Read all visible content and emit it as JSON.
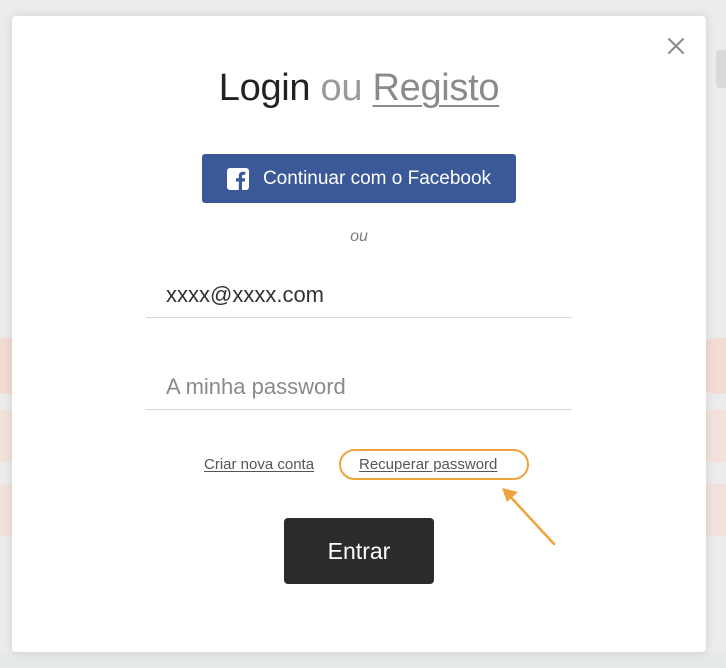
{
  "modal": {
    "title": {
      "login": "Login",
      "separator": "ou",
      "register_link": "Registo"
    },
    "close_icon": "close-icon",
    "facebook_button": {
      "label": "Continuar com o Facebook",
      "icon": "facebook-icon",
      "color": "#3b5998"
    },
    "divider_text": "ou",
    "email_input": {
      "value": "xxxx@xxxx.com"
    },
    "password_input": {
      "placeholder": "A minha password",
      "value": ""
    },
    "links": {
      "create_account": "Criar nova conta",
      "recover_password": "Recuperar password"
    },
    "submit_button": {
      "label": "Entrar",
      "color": "#2b2b2b"
    },
    "annotation": {
      "color": "#f0a23c",
      "target": "recover_password"
    }
  }
}
